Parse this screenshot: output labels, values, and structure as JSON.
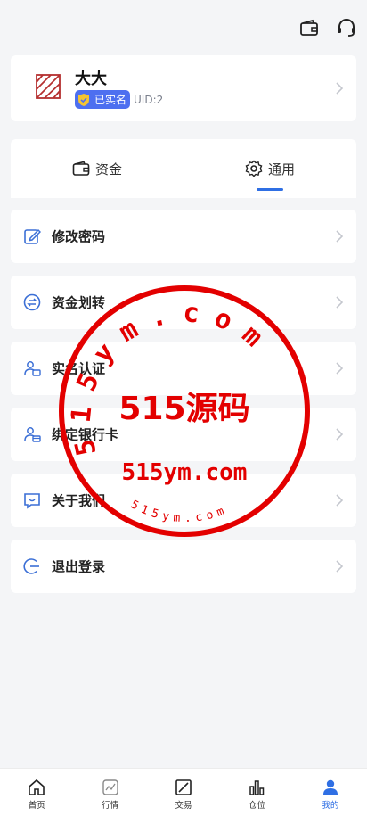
{
  "topbar": {
    "wallet_icon": "wallet-icon",
    "support_icon": "headset-icon"
  },
  "profile": {
    "name": "大大",
    "verified_label": "已实名",
    "uid": "UID:2"
  },
  "tabs": [
    {
      "label": "资金",
      "icon": "wallet-icon"
    },
    {
      "label": "通用",
      "icon": "gear-icon",
      "active": true
    }
  ],
  "menu": [
    {
      "label": "修改密码",
      "icon": "edit-icon"
    },
    {
      "label": "资金划转",
      "icon": "transfer-icon"
    },
    {
      "label": "实名认证",
      "icon": "id-card-icon"
    },
    {
      "label": "绑定银行卡",
      "icon": "bank-card-icon"
    },
    {
      "label": "关于我们",
      "icon": "chat-icon"
    },
    {
      "label": "退出登录",
      "icon": "logout-icon"
    }
  ],
  "watermark": {
    "ring_text": "515ym.com",
    "center_text": "515源码",
    "domain_text": "515ym.com",
    "bottom_text": "515ym.com"
  },
  "bottom_nav": [
    {
      "label": "首页",
      "icon": "home-icon"
    },
    {
      "label": "行情",
      "icon": "chart-icon"
    },
    {
      "label": "交易",
      "icon": "trade-icon"
    },
    {
      "label": "仓位",
      "icon": "bar-chart-icon"
    },
    {
      "label": "我的",
      "icon": "user-icon",
      "active": true
    }
  ],
  "colors": {
    "accent": "#2f6fe4",
    "badge": "#4d6ff0",
    "stamp": "#e30000",
    "logo": "#b53030"
  }
}
